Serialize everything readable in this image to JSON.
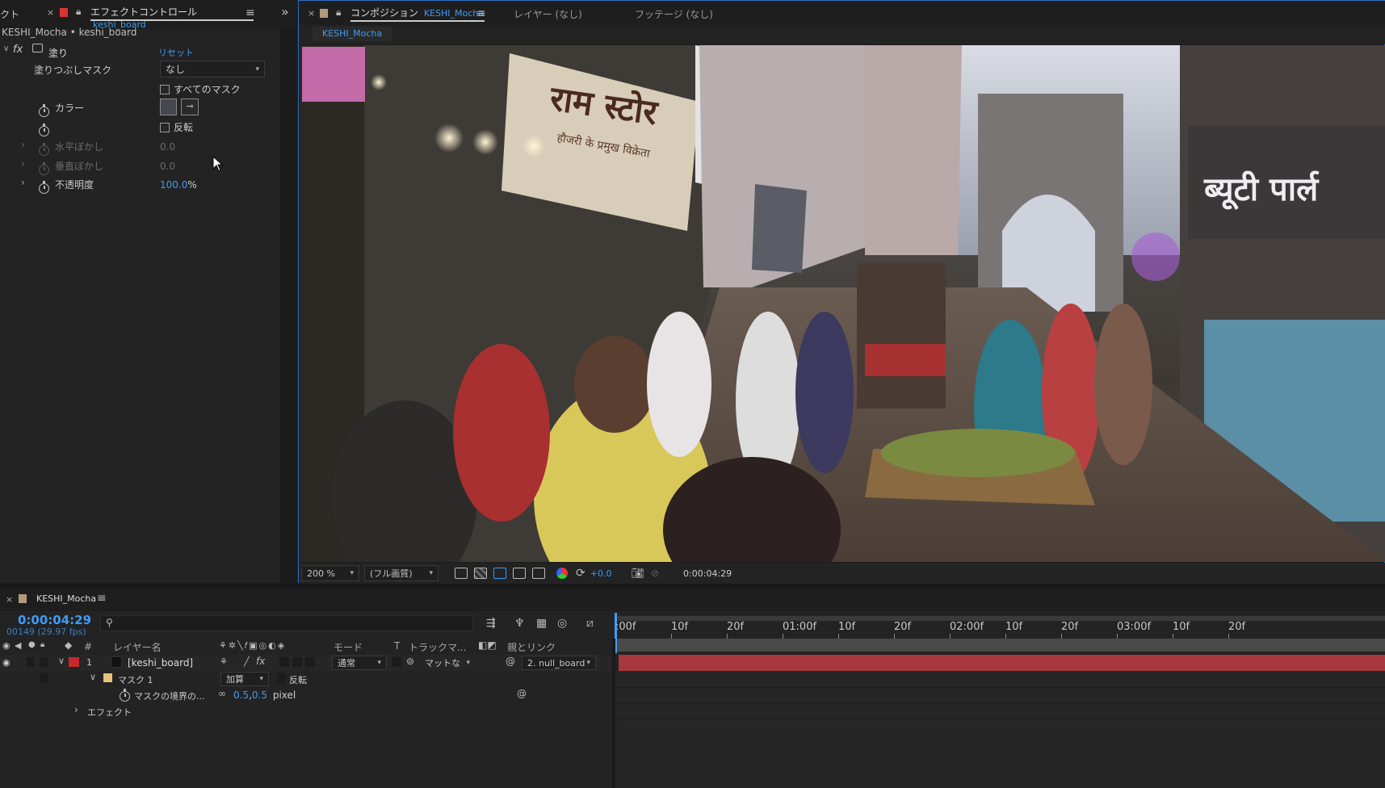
{
  "effects_panel": {
    "prev_tab_stub": "クト",
    "tab_title": "エフェクトコントロール",
    "tab_layer": "keshi_board",
    "breadcrumb": "KESHI_Mocha • keshi_board",
    "effect_name": "塗り",
    "fx_label": "fx",
    "reset_label": "リセット",
    "props": {
      "fill_mask_label": "塗りつぶしマスク",
      "fill_mask_value": "なし",
      "all_masks_label": "すべてのマスク",
      "color_label": "カラー",
      "color_value": "#45474f",
      "invert_label": "反転",
      "h_feather_label": "水平ぼかし",
      "h_feather_value": "0.0",
      "v_feather_label": "垂直ぼかし",
      "v_feather_value": "0.0",
      "opacity_label": "不透明度",
      "opacity_value": "100.0",
      "opacity_unit": "%"
    }
  },
  "composition_panel": {
    "tab_title": "コンポジション",
    "tab_comp": "KESHI_Mocha",
    "layer_tab": "レイヤー (なし)",
    "footage_tab": "フッテージ (なし)",
    "subtab": "KESHI_Mocha",
    "viewer_sign_text": "राम स्टोर",
    "viewer_sign_subtext": "हौजरी के प्रमुख विक्रेता",
    "viewer_right_text": "ब्यूटी पार्ल",
    "toolbar": {
      "zoom": "200 %",
      "resolution": "(フル画質)",
      "exposure": "+0.0",
      "timecode": "0:00:04:29"
    }
  },
  "timeline": {
    "tab_title": "KESHI_Mocha",
    "current_time": "0:00:04:29",
    "frame_info": "00149 (29.97 fps)",
    "search_placeholder": "",
    "ruler_labels": [
      ":00f",
      "10f",
      "20f",
      "01:00f",
      "10f",
      "20f",
      "02:00f",
      "10f",
      "20f",
      "03:00f",
      "10f",
      "20f"
    ],
    "columns": {
      "hash": "#",
      "layer_name": "レイヤー名",
      "mode": "モード",
      "t": "T",
      "track_matte": "トラックマ...",
      "parent": "親とリンク"
    },
    "layer": {
      "number": "1",
      "name": "[keshi_board]",
      "mode": "通常",
      "matte": "マットな",
      "parent": "2. null_board",
      "label_color": "#c8282c"
    },
    "mask": {
      "name": "マスク 1",
      "mode": "加算",
      "invert": "反転",
      "feather_label": "マスクの境界の...",
      "feather_value_a": "0.5",
      "feather_sep": ",",
      "feather_value_b": "0.5",
      "feather_unit": "pixel"
    },
    "effects_label": "エフェクト"
  }
}
